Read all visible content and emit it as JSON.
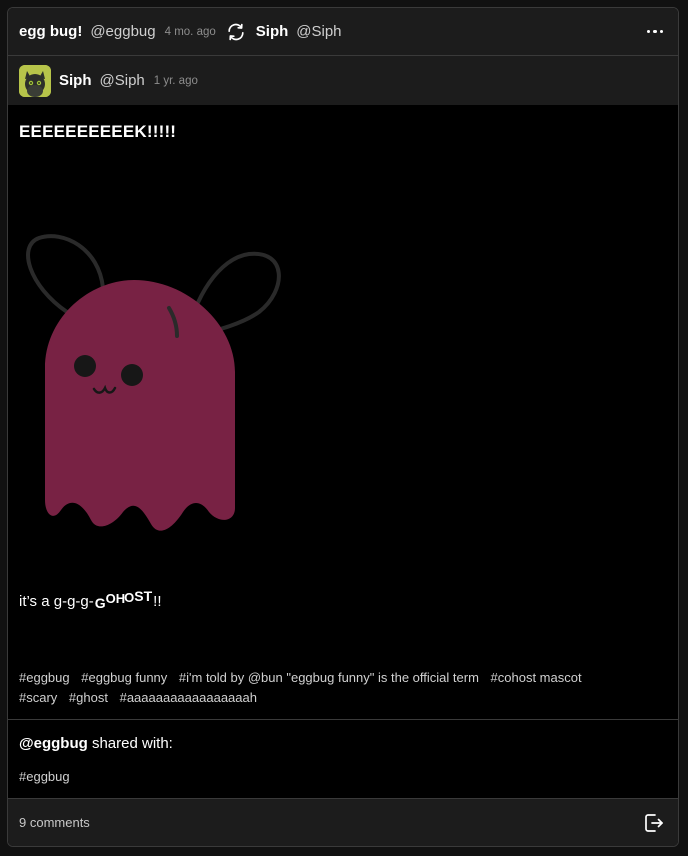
{
  "header": {
    "reposter_name": "egg bug!",
    "reposter_handle": "@eggbug",
    "repost_time": "4 mo. ago",
    "author_name": "Siph",
    "author_handle": "@Siph",
    "icons": {
      "repost": "repost-icon",
      "more": "more-options-icon"
    }
  },
  "original": {
    "author_name": "Siph",
    "author_handle": "@Siph",
    "time": "1 yr. ago"
  },
  "post": {
    "title": "EEEEEEEEEEK!!!!!",
    "caption_prefix": "it’s a g-g-g-",
    "caption_g1": "G",
    "caption_g2": "OH",
    "caption_g3": "O",
    "caption_g4": "ST",
    "caption_suffix": "!!",
    "image": "ghost-eggbug-image",
    "tags": [
      "#eggbug",
      "#eggbug funny",
      "#i'm told by @bun \"eggbug funny\" is the official term",
      "#cohost mascot",
      "#scary",
      "#ghost",
      "#aaaaaaaaaaaaaaaaah"
    ]
  },
  "share": {
    "user": "@eggbug",
    "text": " shared with:",
    "tag": "#eggbug"
  },
  "footer": {
    "comments": "9 comments",
    "share_icon": "share-exit-icon"
  },
  "colors": {
    "ghost_body": "#782244",
    "ghost_antenna": "#2a2a2a",
    "bar_background": "#1c1c1c",
    "avatar": "#b7c44a"
  }
}
